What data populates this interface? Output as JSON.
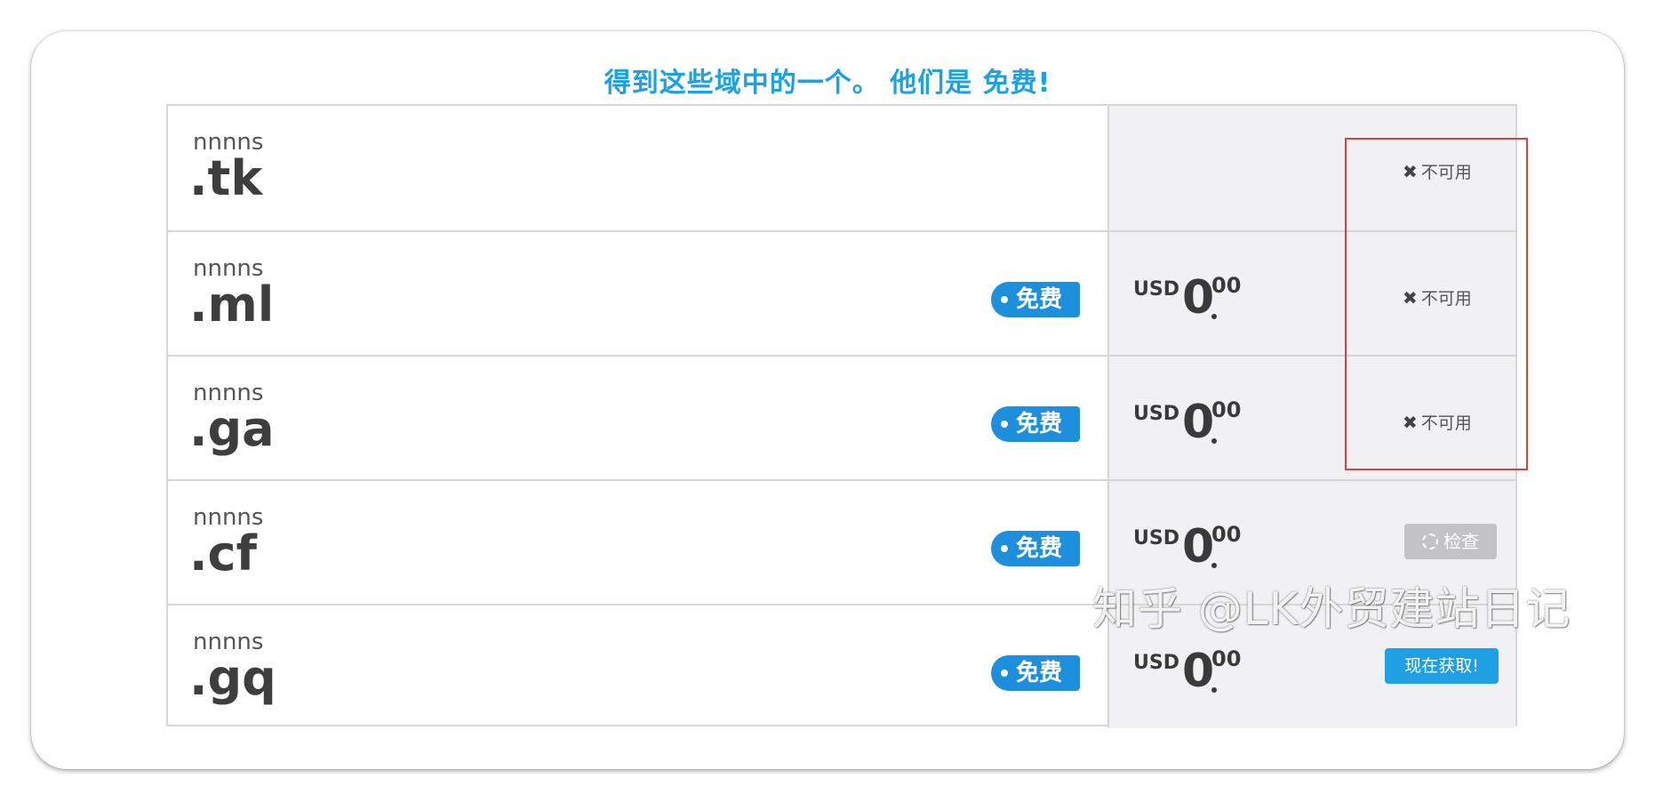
{
  "page": {
    "heading": "得到这些域中的一个。 他们是 免费!"
  },
  "colors": {
    "accent": "#1da1e0",
    "badge": "#1e8fdc",
    "highlight": "#d94040",
    "disabled_button": "#c3c3c5"
  },
  "domains": [
    {
      "name": "nnnns",
      "tld": ".tk",
      "badge": null,
      "price": null,
      "status": {
        "type": "unavailable",
        "icon": "x-icon",
        "label": "不可用"
      }
    },
    {
      "name": "nnnns",
      "tld": ".ml",
      "badge": "免费",
      "price": {
        "currency": "USD",
        "integer": "0",
        "decimal": "00"
      },
      "status": {
        "type": "unavailable",
        "icon": "x-icon",
        "label": "不可用"
      }
    },
    {
      "name": "nnnns",
      "tld": ".ga",
      "badge": "免费",
      "price": {
        "currency": "USD",
        "integer": "0",
        "decimal": "00"
      },
      "status": {
        "type": "unavailable",
        "icon": "x-icon",
        "label": "不可用"
      }
    },
    {
      "name": "nnnns",
      "tld": ".cf",
      "badge": "免费",
      "price": {
        "currency": "USD",
        "integer": "0",
        "decimal": "00"
      },
      "status": {
        "type": "check",
        "icon": "spinner-icon",
        "label": "检查"
      }
    },
    {
      "name": "nnnns",
      "tld": ".gq",
      "badge": "免费",
      "price": {
        "currency": "USD",
        "integer": "0",
        "decimal": "00"
      },
      "status": {
        "type": "get",
        "label": "现在获取!"
      }
    }
  ],
  "watermark": "知乎 @LK外贸建站日记"
}
